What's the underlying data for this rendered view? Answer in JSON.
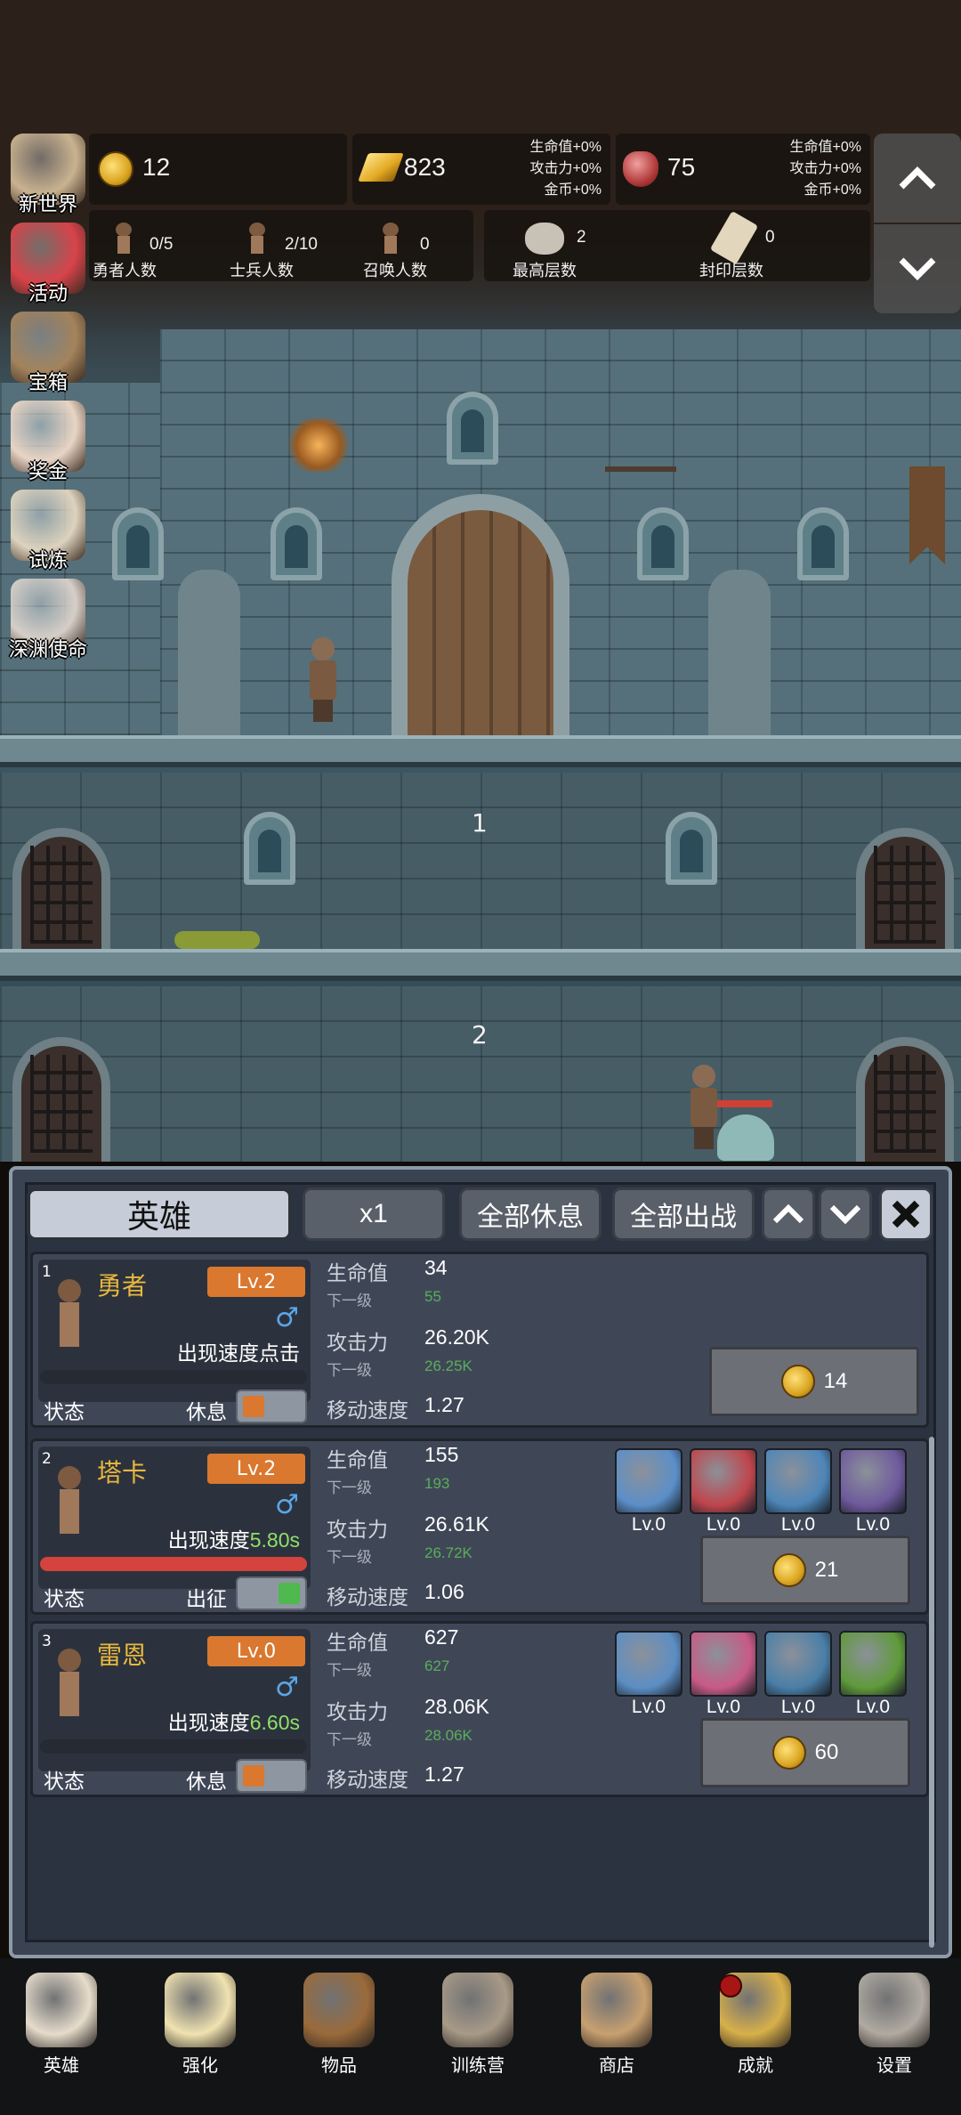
{
  "hud": {
    "gold_coins": "12",
    "gold_bars": "823",
    "gold_bar_bonus": [
      "生命值+0%",
      "攻击力+0%",
      "金币+0%"
    ],
    "gems": "75",
    "gem_bonus": [
      "生命值+0%",
      "攻击力+0%",
      "金币+0%"
    ],
    "hero_count_value": "0/5",
    "hero_count_label": "勇者人数",
    "soldier_count_value": "2/10",
    "soldier_count_label": "士兵人数",
    "summon_count_value": "0",
    "summon_count_label": "召唤人数",
    "max_floor_value": "2",
    "max_floor_label": "最高层数",
    "sealed_floor_value": "0",
    "sealed_floor_label": "封印层数"
  },
  "side_menu": [
    {
      "label": "新世界",
      "icon": "map-scroll-icon",
      "color": "#c9b28f"
    },
    {
      "label": "活动",
      "icon": "heart-icon",
      "color": "#d8434a"
    },
    {
      "label": "宝箱",
      "icon": "treasure-chest-icon",
      "color": "#a3835c"
    },
    {
      "label": "奖金",
      "icon": "envelope-icon",
      "color": "#e8d4c4"
    },
    {
      "label": "试炼",
      "icon": "feather-quill-icon",
      "color": "#ddd2bd"
    },
    {
      "label": "深渊使命",
      "icon": "pearl-orb-icon",
      "color": "#d6cec7"
    }
  ],
  "floors": [
    "1",
    "2"
  ],
  "panel": {
    "tabs": {
      "hero": "英雄",
      "speed": "x1",
      "rest_all": "全部休息",
      "deploy_all": "全部出战"
    },
    "heroes": [
      {
        "index": "1",
        "name": "勇者",
        "level": "Lv.2",
        "gender": "♂",
        "appear_prefix": "出现速度点击",
        "appear_value": "",
        "hp_bar": 0,
        "status_label": "状态",
        "status_value": "休息",
        "toggle_on": false,
        "hp_label": "生命值",
        "hp": "34",
        "hp_next_label": "下一级",
        "hp_next": "55",
        "atk_label": "攻击力",
        "atk": "26.20K",
        "atk_next_label": "下一级",
        "atk_next": "26.25K",
        "speed_label": "移动速度",
        "speed": "1.27",
        "upgrade_cost": "14",
        "equipment": []
      },
      {
        "index": "2",
        "name": "塔卡",
        "level": "Lv.2",
        "gender": "♂",
        "appear_prefix": "出现速度",
        "appear_value": "5.80s",
        "hp_bar": 1,
        "status_label": "状态",
        "status_value": "出征",
        "toggle_on": true,
        "hp_label": "生命值",
        "hp": "155",
        "hp_next_label": "下一级",
        "hp_next": "193",
        "atk_label": "攻击力",
        "atk": "26.61K",
        "atk_next_label": "下一级",
        "atk_next": "26.72K",
        "speed_label": "移动速度",
        "speed": "1.06",
        "upgrade_cost": "21",
        "equipment": [
          {
            "icon": "helmet-icon",
            "level": "Lv.0",
            "color": "#5b8fc8"
          },
          {
            "icon": "axe-icon",
            "level": "Lv.0",
            "color": "#c0454c"
          },
          {
            "icon": "boots-icon",
            "level": "Lv.0",
            "color": "#4d86b8"
          },
          {
            "icon": "hammer-icon",
            "level": "Lv.0",
            "color": "#6e5a9c"
          }
        ]
      },
      {
        "index": "3",
        "name": "雷恩",
        "level": "Lv.0",
        "gender": "♂",
        "appear_prefix": "出现速度",
        "appear_value": "6.60s",
        "hp_bar": 0,
        "status_label": "状态",
        "status_value": "休息",
        "toggle_on": false,
        "hp_label": "生命值",
        "hp": "627",
        "hp_next_label": "下一级",
        "hp_next": "627",
        "atk_label": "攻击力",
        "atk": "28.06K",
        "atk_next_label": "下一级",
        "atk_next": "28.06K",
        "speed_label": "移动速度",
        "speed": "1.27",
        "upgrade_cost": "60",
        "equipment": [
          {
            "icon": "sword-icon",
            "level": "Lv.0",
            "color": "#5c8ec4"
          },
          {
            "icon": "dagger-icon",
            "level": "Lv.0",
            "color": "#c85a86"
          },
          {
            "icon": "boots-icon",
            "level": "Lv.0",
            "color": "#4a7fa8"
          },
          {
            "icon": "snake-icon",
            "level": "Lv.0",
            "color": "#5f9a3a"
          }
        ]
      }
    ]
  },
  "bottom_nav": [
    {
      "label": "英雄",
      "icon": "skull-icon",
      "color": "#e6dccb"
    },
    {
      "label": "强化",
      "icon": "candle-icon",
      "color": "#f0e2b0"
    },
    {
      "label": "物品",
      "icon": "book-icon",
      "color": "#9a6a3a"
    },
    {
      "label": "训练营",
      "icon": "lantern-icon",
      "color": "#a89a88"
    },
    {
      "label": "商店",
      "icon": "beer-mug-icon",
      "color": "#c8a070"
    },
    {
      "label": "成就",
      "icon": "key-icon",
      "color": "#d8b04a"
    },
    {
      "label": "设置",
      "icon": "gear-icon",
      "color": "#b0aaa2"
    }
  ],
  "colors": {
    "level_badge": "#d9782e",
    "hero_name": "#e8b83e",
    "next_level_value": "#5aae5a",
    "appear_speed_value": "#8ee06a",
    "hp_bar": "#d4433e",
    "toggle_rest": "#d9782e",
    "toggle_deploy": "#4fb84f"
  }
}
